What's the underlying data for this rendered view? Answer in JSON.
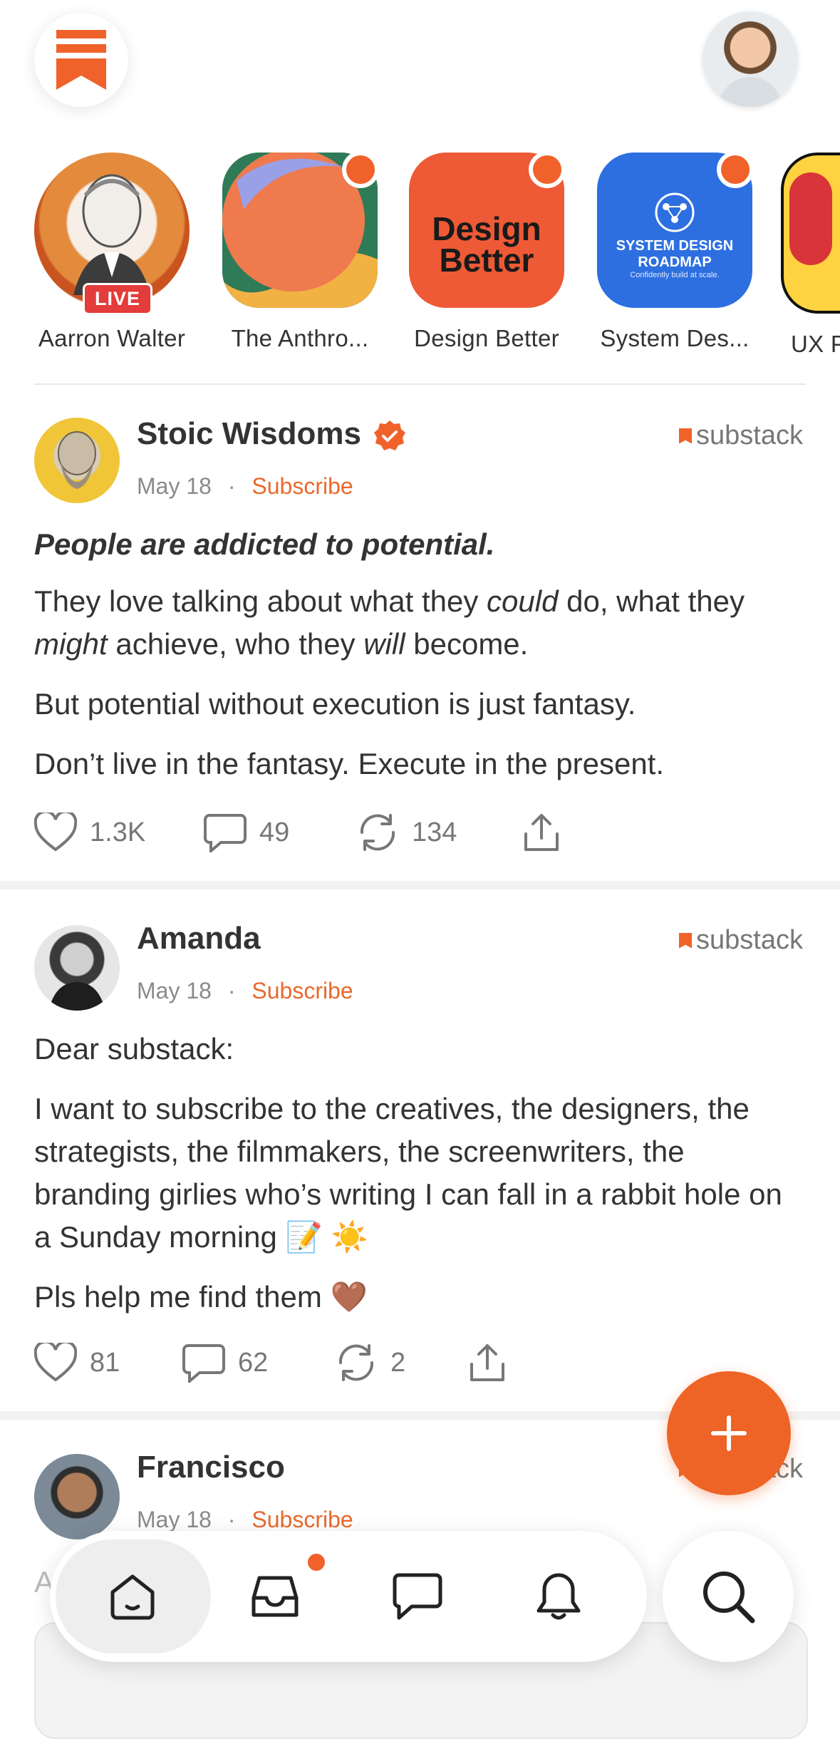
{
  "header": {
    "logo_icon": "substack-bookmark-icon",
    "profile_icon": "profile-avatar"
  },
  "stories": [
    {
      "name": "Aarron Walter",
      "badge": "LIVE"
    },
    {
      "name": "The Anthro..."
    },
    {
      "name": "Design Better",
      "logo_text_line1": "Design",
      "logo_text_line2": "Better"
    },
    {
      "name": "System Des...",
      "logo_line1": "SYSTEM DESIGN",
      "logo_line2": "ROADMAP",
      "logo_line3": "Confidently build at scale."
    },
    {
      "name": "UX P"
    }
  ],
  "posts": [
    {
      "author": "Stoic Wisdoms",
      "verified": true,
      "date": "May 18",
      "separator": "·",
      "subscribe": "Subscribe",
      "brand": "substack",
      "headline": "People are addicted to potential.",
      "body": {
        "p1_a": "They love talking about what they ",
        "p1_could": "could",
        "p1_b": " do, what they ",
        "p1_might": "might",
        "p1_c": " achieve, who they ",
        "p1_will": "will",
        "p1_d": " become.",
        "p2": "But potential without execution is just fantasy.",
        "p3": "Don’t live in the fantasy. Execute in the present."
      },
      "likes": "1.3K",
      "comments": "49",
      "restacks": "134"
    },
    {
      "author": "Amanda",
      "date": "May 18",
      "separator": "·",
      "subscribe": "Subscribe",
      "brand": "substack",
      "body": {
        "p1": "Dear substack:",
        "p2": "I want to subscribe to the creatives, the designers, the strategists, the filmmakers, the screenwriters, the branding girlies who’s writing I can fall in a rabbit hole on a Sunday morning 📝 ☀️",
        "p3": "Pls help me find them 🤎"
      },
      "likes": "81",
      "comments": "62",
      "restacks": "2"
    },
    {
      "author": "Francisco",
      "date": "May 18",
      "separator": "·",
      "subscribe": "Subscribe",
      "brand": "substack",
      "body_preview": "A"
    }
  ],
  "fab": {
    "icon": "plus-icon"
  },
  "bottom_nav": [
    {
      "name": "home",
      "icon": "home-icon",
      "active": true
    },
    {
      "name": "inbox",
      "icon": "inbox-icon",
      "unread": true
    },
    {
      "name": "chat",
      "icon": "chat-icon"
    },
    {
      "name": "notifications",
      "icon": "bell-icon"
    },
    {
      "name": "search",
      "icon": "search-icon"
    }
  ],
  "colors": {
    "accent": "#f0622a",
    "live": "#e33c3a",
    "text": "#333333",
    "muted": "#8a8a8a"
  }
}
